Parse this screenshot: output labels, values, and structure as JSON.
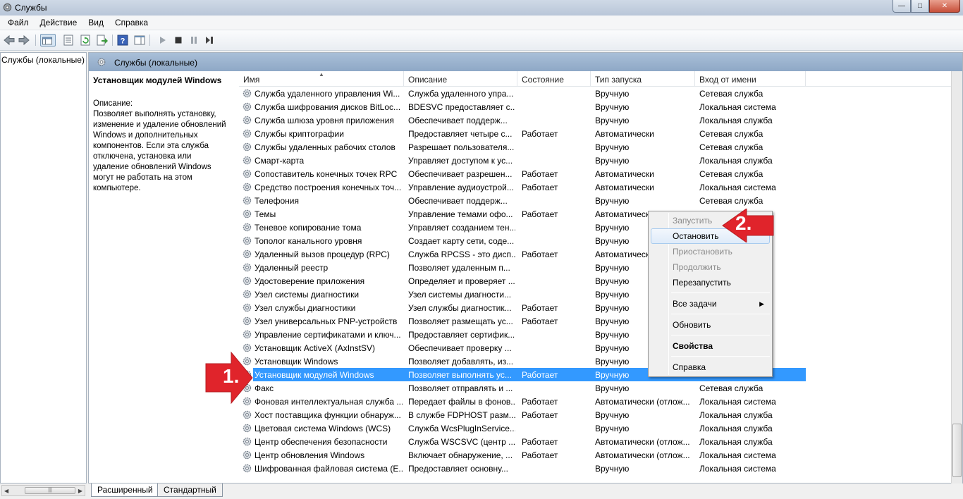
{
  "window": {
    "title": "Службы",
    "minimize": "—",
    "maximize": "□",
    "close": "✕"
  },
  "menubar": [
    "Файл",
    "Действие",
    "Вид",
    "Справка"
  ],
  "tree": {
    "root": "Службы (локальные)"
  },
  "header": {
    "title": "Службы (локальные)"
  },
  "details": {
    "service_name": "Установщик модулей Windows",
    "description_label": "Описание:",
    "description_text": "Позволяет выполнять установку,\nизменение и удаление обновлений\nWindows и дополнительных\nкомпонентов. Если эта служба\nотключена, установка или\nудаление обновлений Windows\nмогут не работать на этом\nкомпьютере."
  },
  "columns": {
    "name": "Имя",
    "description": "Описание",
    "state": "Состояние",
    "startup": "Тип запуска",
    "logon": "Вход от имени"
  },
  "rows": [
    {
      "name": "Служба удаленного управления Wi...",
      "desc": "Служба удаленного упра...",
      "state": "",
      "start": "Вручную",
      "logon": "Сетевая служба"
    },
    {
      "name": "Служба шифрования дисков BitLoc...",
      "desc": "BDESVC предоставляет с...",
      "state": "",
      "start": "Вручную",
      "logon": "Локальная система"
    },
    {
      "name": "Служба шлюза уровня приложения",
      "desc": "Обеспечивает поддерж...",
      "state": "",
      "start": "Вручную",
      "logon": "Локальная служба"
    },
    {
      "name": "Службы криптографии",
      "desc": "Предоставляет четыре с...",
      "state": "Работает",
      "start": "Автоматически",
      "logon": "Сетевая служба"
    },
    {
      "name": "Службы удаленных рабочих столов",
      "desc": "Разрешает пользователя...",
      "state": "",
      "start": "Вручную",
      "logon": "Сетевая служба"
    },
    {
      "name": "Смарт-карта",
      "desc": "Управляет доступом к ус...",
      "state": "",
      "start": "Вручную",
      "logon": "Локальная служба"
    },
    {
      "name": "Сопоставитель конечных точек RPC",
      "desc": "Обеспечивает разрешен...",
      "state": "Работает",
      "start": "Автоматически",
      "logon": "Сетевая служба"
    },
    {
      "name": "Средство построения конечных точ...",
      "desc": "Управление аудиоустрой...",
      "state": "Работает",
      "start": "Автоматически",
      "logon": "Локальная система"
    },
    {
      "name": "Телефония",
      "desc": "Обеспечивает поддерж...",
      "state": "",
      "start": "Вручную",
      "logon": "Сетевая служба"
    },
    {
      "name": "Темы",
      "desc": "Управление темами офо...",
      "state": "Работает",
      "start": "Автоматически",
      "logon": ""
    },
    {
      "name": "Теневое копирование тома",
      "desc": "Управляет созданием тен...",
      "state": "",
      "start": "Вручную",
      "logon": ""
    },
    {
      "name": "Тополог канального уровня",
      "desc": "Создает карту сети, соде...",
      "state": "",
      "start": "Вручную",
      "logon": ""
    },
    {
      "name": "Удаленный вызов процедур (RPC)",
      "desc": "Служба RPCSS - это дисп...",
      "state": "Работает",
      "start": "Автоматически",
      "logon": ""
    },
    {
      "name": "Удаленный реестр",
      "desc": "Позволяет удаленным п...",
      "state": "",
      "start": "Вручную",
      "logon": ""
    },
    {
      "name": "Удостоверение приложения",
      "desc": "Определяет и проверяет ...",
      "state": "",
      "start": "Вручную",
      "logon": ""
    },
    {
      "name": "Узел системы диагностики",
      "desc": "Узел системы диагности...",
      "state": "",
      "start": "Вручную",
      "logon": ""
    },
    {
      "name": "Узел службы диагностики",
      "desc": "Узел службы диагностик...",
      "state": "Работает",
      "start": "Вручную",
      "logon": ""
    },
    {
      "name": "Узел универсальных PNP-устройств",
      "desc": "Позволяет размещать ус...",
      "state": "Работает",
      "start": "Вручную",
      "logon": ""
    },
    {
      "name": "Управление сертификатами и ключ...",
      "desc": "Предоставляет сертифик...",
      "state": "",
      "start": "Вручную",
      "logon": ""
    },
    {
      "name": "Установщик ActiveX (AxInstSV)",
      "desc": "Обеспечивает проверку ...",
      "state": "",
      "start": "Вручную",
      "logon": ""
    },
    {
      "name": "Установщик Windows",
      "desc": "Позволяет добавлять, из...",
      "state": "",
      "start": "Вручную",
      "logon": ""
    },
    {
      "name": "Установщик модулей Windows",
      "desc": "Позволяет выполнять ус...",
      "state": "Работает",
      "start": "Вручную",
      "logon": "",
      "selected": true
    },
    {
      "name": "Факс",
      "desc": "Позволяет отправлять и ...",
      "state": "",
      "start": "Вручную",
      "logon": "Сетевая служба"
    },
    {
      "name": "Фоновая интеллектуальная служба ...",
      "desc": "Передает файлы в фонов...",
      "state": "Работает",
      "start": "Автоматически (отлож...",
      "logon": "Локальная система"
    },
    {
      "name": "Хост поставщика функции обнаруж...",
      "desc": "В службе FDPHOST разм...",
      "state": "Работает",
      "start": "Вручную",
      "logon": "Локальная служба"
    },
    {
      "name": "Цветовая система Windows (WCS)",
      "desc": "Служба WcsPlugInService...",
      "state": "",
      "start": "Вручную",
      "logon": "Локальная служба"
    },
    {
      "name": "Центр обеспечения безопасности",
      "desc": "Служба WSCSVC (центр ...",
      "state": "Работает",
      "start": "Автоматически (отлож...",
      "logon": "Локальная служба"
    },
    {
      "name": "Центр обновления Windows",
      "desc": "Включает обнаружение, ...",
      "state": "Работает",
      "start": "Автоматически (отлож...",
      "logon": "Локальная система"
    },
    {
      "name": "Шифрованная файловая система (E...",
      "desc": "Предоставляет основну...",
      "state": "",
      "start": "Вручную",
      "logon": "Локальная система"
    }
  ],
  "context_menu": {
    "start": "Запустить",
    "stop": "Остановить",
    "pause": "Приостановить",
    "resume": "Продолжить",
    "restart": "Перезапустить",
    "all_tasks": "Все задачи",
    "refresh": "Обновить",
    "properties": "Свойства",
    "help": "Справка"
  },
  "tabs": {
    "extended": "Расширенный",
    "standard": "Стандартный"
  },
  "annotations": {
    "step1": "1.",
    "step2": "2."
  },
  "colors": {
    "selection": "#3399ff",
    "arrow": "#e0242b",
    "header": "#9fb5d0"
  }
}
